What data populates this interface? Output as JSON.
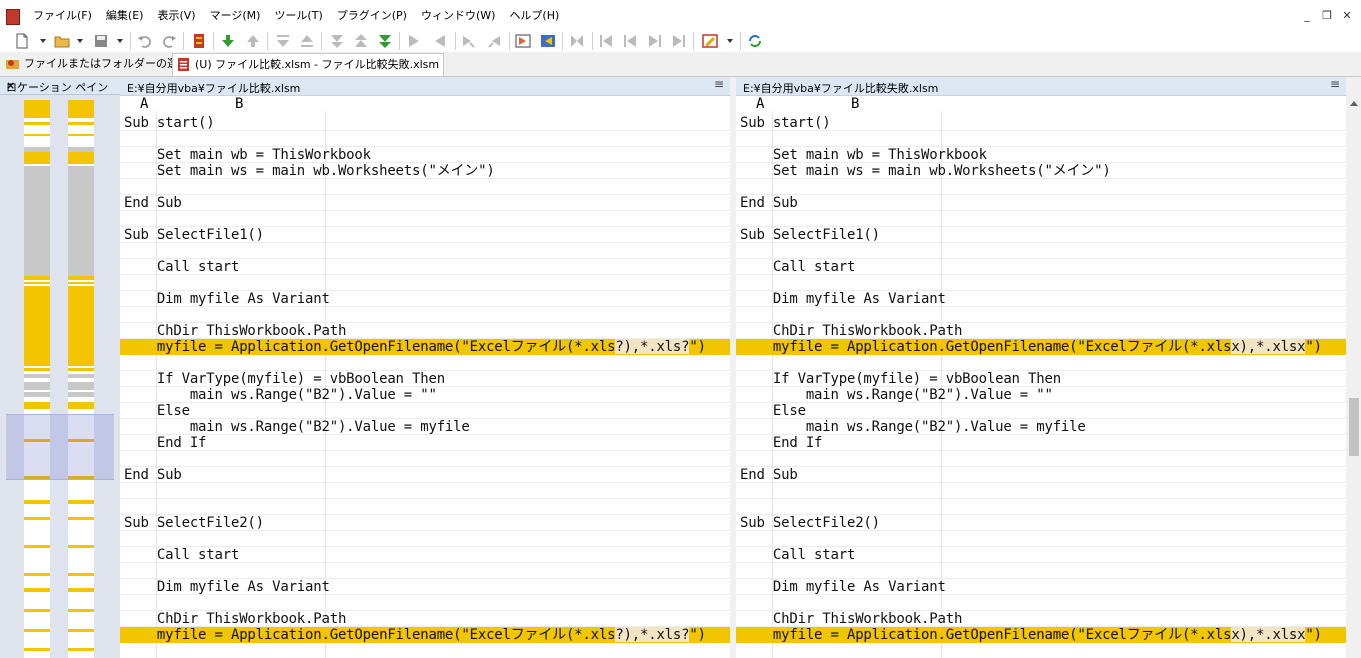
{
  "menu": {
    "items": [
      "ファイル(F)",
      "編集(E)",
      "表示(V)",
      "マージ(M)",
      "ツール(T)",
      "プラグイン(P)",
      "ウィンドウ(W)",
      "ヘルプ(H)"
    ],
    "window_buttons": [
      "_",
      "❐",
      "✕"
    ]
  },
  "tabs": {
    "select": "ファイルまたはフォルダーの選択",
    "doc": "(U) ファイル比較.xlsm - ファイル比較失敗.xlsm"
  },
  "location_pane": {
    "title": "ロケーション ペイン",
    "close": "×"
  },
  "colors": {
    "diff": "#f2c500",
    "inline_diff": "#f3e4c4",
    "header_bg": "#dde6f3"
  },
  "left": {
    "path": "E:¥自分用vba¥ファイル比較.xlsm",
    "col_a": "A",
    "col_b": "B",
    "menu_icon": "≡",
    "lines": [
      "Sub start()",
      "",
      "    Set main_wb = ThisWorkbook",
      "    Set main_ws = main_wb.Worksheets(\"メイン\")",
      "",
      "End Sub",
      "",
      "Sub SelectFile1()",
      "",
      "    Call start",
      "",
      "    Dim myfile As Variant",
      "",
      "    ChDir ThisWorkbook.Path",
      "    myfile = Application.GetOpenFilename(\"Excelファイル(*.xls?),*.xls?\")",
      "",
      "    If VarType(myfile) = vbBoolean Then",
      "        main_ws.Range(\"B2\").Value = \"\"",
      "    Else",
      "        main_ws.Range(\"B2\").Value = myfile",
      "    End If",
      "",
      "End Sub",
      "",
      "",
      "Sub SelectFile2()",
      "",
      "    Call start",
      "",
      "    Dim myfile As Variant",
      "",
      "    ChDir ThisWorkbook.Path",
      "    myfile = Application.GetOpenFilename(\"Excelファイル(*.xls?),*.xls?\")"
    ]
  },
  "right": {
    "path": "E:¥自分用vba¥ファイル比較失敗.xlsm",
    "col_a": "A",
    "col_b": "B",
    "menu_icon": "≡",
    "lines": [
      "Sub start()",
      "",
      "    Set main_wb = ThisWorkbook",
      "    Set main_ws = main_wb.Worksheets(\"メイン\")",
      "",
      "End Sub",
      "",
      "Sub SelectFile1()",
      "",
      "    Call start",
      "",
      "    Dim myfile As Variant",
      "",
      "    ChDir ThisWorkbook.Path",
      "    myfile = Application.GetOpenFilename(\"Excelファイル(*.xlsx),*.xlsx\")",
      "",
      "    If VarType(myfile) = vbBoolean Then",
      "        main_ws.Range(\"B2\").Value = \"\"",
      "    Else",
      "        main_ws.Range(\"B2\").Value = myfile",
      "    End If",
      "",
      "End Sub",
      "",
      "",
      "Sub SelectFile2()",
      "",
      "    Call start",
      "",
      "    Dim myfile As Variant",
      "",
      "    ChDir ThisWorkbook.Path",
      "    myfile = Application.GetOpenFilename(\"Excelファイル(*.xlsx),*.xlsx\")"
    ]
  },
  "diff_lines": [
    14,
    32
  ]
}
